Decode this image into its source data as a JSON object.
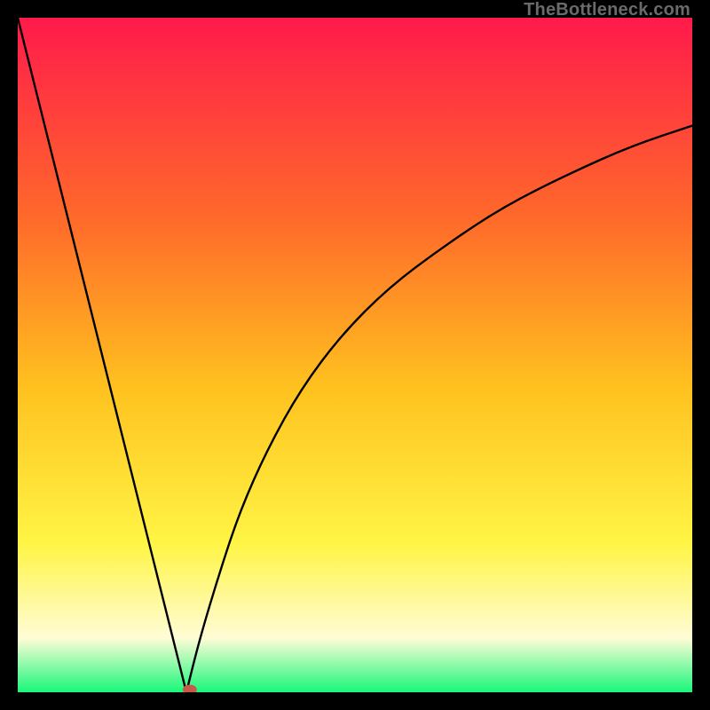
{
  "attribution": "TheBottleneck.com",
  "colors": {
    "top": "#ff1a4b",
    "upper_mid": "#ff6a2a",
    "mid": "#ffc21f",
    "lower_mid": "#fff545",
    "pale": "#fffcd6",
    "green": "#19f77a",
    "curve": "#000000",
    "marker": "#c55a4a"
  },
  "chart_data": {
    "type": "line",
    "title": "",
    "xlabel": "",
    "ylabel": "",
    "xlim": [
      0,
      100
    ],
    "ylim": [
      0,
      100
    ],
    "marker": {
      "x": 25.5,
      "y": 0
    },
    "left_segment": {
      "x": [
        0,
        25
      ],
      "y": [
        100,
        0
      ]
    },
    "right_curve": {
      "x": [
        25,
        27,
        30,
        33,
        37,
        42,
        48,
        55,
        63,
        72,
        82,
        91,
        100
      ],
      "y": [
        0,
        8,
        18,
        27,
        36,
        45,
        53,
        60,
        66,
        72,
        77,
        81,
        84
      ]
    }
  }
}
